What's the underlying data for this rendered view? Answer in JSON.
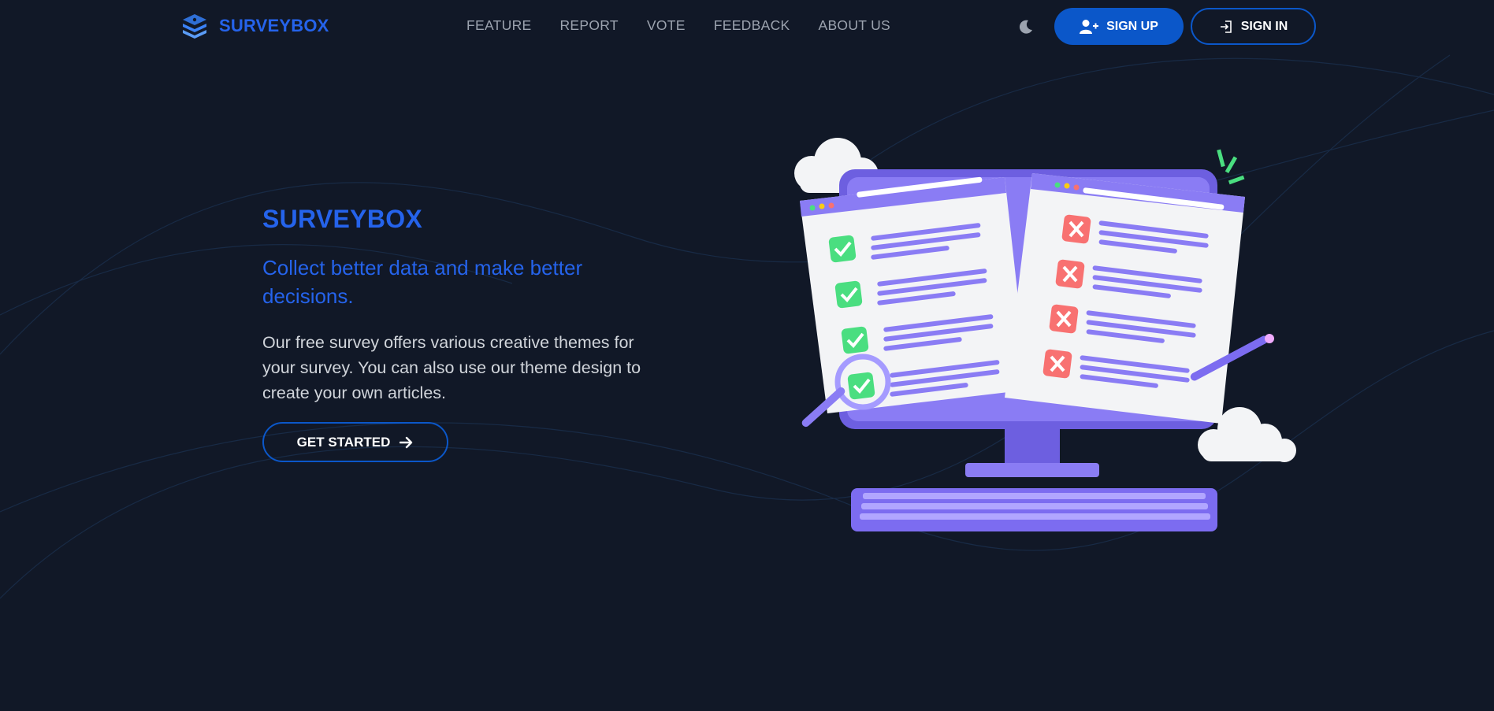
{
  "brand": {
    "name": "SURVEYBOX"
  },
  "nav": {
    "items": [
      {
        "label": "FEATURE"
      },
      {
        "label": "REPORT"
      },
      {
        "label": "VOTE"
      },
      {
        "label": "FEEDBACK"
      },
      {
        "label": "ABOUT US"
      }
    ]
  },
  "header": {
    "signup_label": "SIGN UP",
    "signin_label": "SIGN IN"
  },
  "hero": {
    "title": "SURVEYBOX",
    "subtitle": "Collect better data and make better decisions.",
    "description": "Our free survey offers various creative themes for your survey. You can also use our theme design to create your own articles.",
    "cta_label": "GET STARTED"
  },
  "icons": {
    "logo": "layers-icon",
    "theme": "moon-icon",
    "signup": "user-plus-icon",
    "signin": "sign-in-icon",
    "cta": "arrow-right-icon"
  },
  "colors": {
    "background": "#111827",
    "accent": "#2563eb",
    "button": "#0b57c9",
    "illustration": "#7c6cf0",
    "check": "#4ade80",
    "cross": "#f87171"
  }
}
